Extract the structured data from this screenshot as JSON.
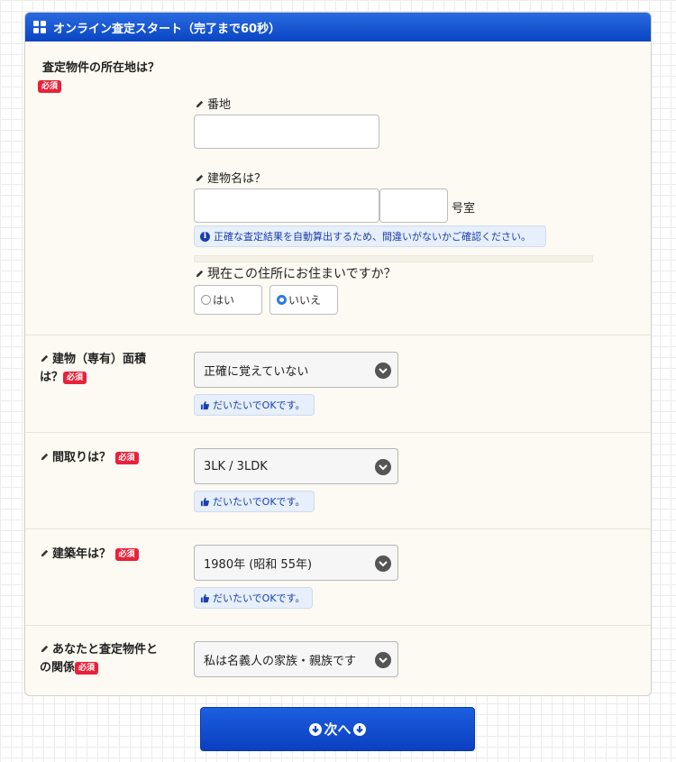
{
  "header": {
    "title": "オンライン査定スタート（完了まで60秒）"
  },
  "required_badge": "必須",
  "location": {
    "label": "査定物件の所在地は？",
    "banchi_label": "番地",
    "building_label": "建物名は？",
    "room_suffix": "号室",
    "notice": "正確な査定結果を自動算出するため、間違いがないかご確認ください。",
    "residence_question": "現在この住所にお住まいですか？",
    "options": [
      "はい",
      "いいえ"
    ],
    "selected": "いいえ"
  },
  "area": {
    "label_line1": "建物（専有）面積",
    "label_line2": "は？",
    "value": "正確に覚えていない",
    "hint": "だいたいでOKです。"
  },
  "layout_q": {
    "label": "間取りは？",
    "value": "3LK / 3LDK",
    "hint": "だいたいでOKです。"
  },
  "built_year": {
    "label": "建築年は？",
    "value": "1980年 (昭和 55年)",
    "hint": "だいたいでOKです。"
  },
  "relation": {
    "label_line1": "あなたと査定物件と",
    "label_line2": "の関係",
    "value": "私は名義人の家族・親族です"
  },
  "next_button": {
    "label": "次へ"
  },
  "colors": {
    "header": "#0a45c4",
    "required": "#e8213a",
    "button": "#0a3fc0"
  }
}
